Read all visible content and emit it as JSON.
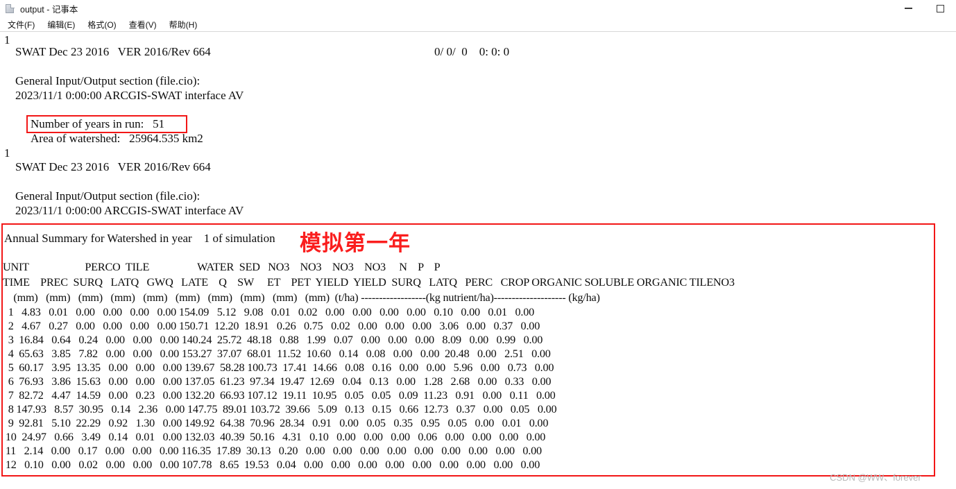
{
  "window": {
    "title": "output - 记事本",
    "icon": "notepad-icon",
    "minimize_label": "−",
    "maximize_label": "□"
  },
  "menu": {
    "items": [
      {
        "label": "文件(F)"
      },
      {
        "label": "编辑(E)"
      },
      {
        "label": "格式(O)"
      },
      {
        "label": "查看(V)"
      },
      {
        "label": "帮助(H)"
      }
    ]
  },
  "document": {
    "page_break_1": "1",
    "header_line_1": "SWAT Dec 23 2016   VER 2016/Rev 664",
    "header_timestamp_1": "0/ 0/  0    0: 0: 0",
    "section_title_1": "General Input/Output section (file.cio):",
    "section_date_1": "2023/11/1 0:00:00 ARCGIS-SWAT interface AV",
    "years_in_run": "Number of years in run:   51",
    "area_of_watershed": "Area of watershed:   25964.535 km2",
    "page_break_2": "1",
    "header_line_2": "SWAT Dec 23 2016   VER 2016/Rev 664",
    "section_title_2": "General Input/Output section (file.cio):",
    "section_date_2": "2023/11/1 0:00:00 ARCGIS-SWAT interface AV",
    "annual_summary_title": "Annual Summary for Watershed in year    1 of simulation",
    "chinese_annotation": "模拟第一年"
  },
  "table": {
    "header_row_1": "UNIT                     PERCO  TILE                  WATER  SED   NO3    NO3    NO3    NO3     N    P    P",
    "header_row_2": "TIME    PREC  SURQ   LATQ   GWQ   LATE    Q    SW     ET    PET  YIELD  YIELD  SURQ   LATQ   PERC   CROP ORGANIC SOLUBLE ORGANIC TILENO3",
    "header_row_3": "    (mm)   (mm)   (mm)   (mm)   (mm)   (mm)   (mm)   (mm)   (mm)   (mm)  (t/ha) ------------------(kg nutrient/ha)-------------------- (kg/ha)",
    "columns": [
      "TIME",
      "PREC",
      "SURQ",
      "LATQ",
      "GWQ",
      "LATE",
      "Q",
      "SW",
      "ET",
      "PET",
      "SED YIELD",
      "NO3 YIELD",
      "NO3 SURQ",
      "NO3 LATQ",
      "NO3 PERC",
      "NO3 CROP",
      "N ORGANIC",
      "P SOLUBLE",
      "P ORGANIC",
      "TILENO3"
    ],
    "rows": [
      {
        "cells": "  1   4.83   0.01   0.00   0.00   0.00   0.00 154.09   5.12   9.08   0.01   0.02   0.00   0.00   0.00   0.00   0.10   0.00   0.01   0.00"
      },
      {
        "cells": "  2   4.67   0.27   0.00   0.00   0.00   0.00 150.71  12.20  18.91   0.26   0.75   0.02   0.00   0.00   0.00   3.06   0.00   0.37   0.00"
      },
      {
        "cells": "  3  16.84   0.64   0.24   0.00   0.00   0.00 140.24  25.72  48.18   0.88   1.99   0.07   0.00   0.00   0.00   8.09   0.00   0.99   0.00"
      },
      {
        "cells": "  4  65.63   3.85   7.82   0.00   0.00   0.00 153.27  37.07  68.01  11.52  10.60   0.14   0.08   0.00   0.00  20.48   0.00   2.51   0.00"
      },
      {
        "cells": "  5  60.17   3.95  13.35   0.00   0.00   0.00 139.67  58.28 100.73  17.41  14.66   0.08   0.16   0.00   0.00   5.96   0.00   0.73   0.00"
      },
      {
        "cells": "  6  76.93   3.86  15.63   0.00   0.00   0.00 137.05  61.23  97.34  19.47  12.69   0.04   0.13   0.00   1.28   2.68   0.00   0.33   0.00"
      },
      {
        "cells": "  7  82.72   4.47  14.59   0.00   0.23   0.00 132.20  66.93 107.12  19.11  10.95   0.05   0.05   0.09  11.23   0.91   0.00   0.11   0.00"
      },
      {
        "cells": "  8 147.93   8.57  30.95   0.14   2.36   0.00 147.75  89.01 103.72  39.66   5.09   0.13   0.15   0.66  12.73   0.37   0.00   0.05   0.00"
      },
      {
        "cells": "  9  92.81   5.10  22.29   0.92   1.30   0.00 149.92  64.38  70.96  28.34   0.91   0.00   0.05   0.35   0.95   0.05   0.00   0.01   0.00"
      },
      {
        "cells": " 10  24.97   0.66   3.49   0.14   0.01   0.00 132.03  40.39  50.16   4.31   0.10   0.00   0.00   0.00   0.06   0.00   0.00   0.00   0.00"
      },
      {
        "cells": " 11   2.14   0.00   0.17   0.00   0.00   0.00 116.35  17.89  30.13   0.20   0.00   0.00   0.00   0.00   0.00   0.00   0.00   0.00   0.00"
      },
      {
        "cells": " 12   0.10   0.00   0.02   0.00   0.00   0.00 107.78   8.65  19.53   0.04   0.00   0.00   0.00   0.00   0.00   0.00   0.00   0.00   0.00"
      }
    ]
  },
  "watermark": {
    "text": "CSDN @WW、forever"
  },
  "colors": {
    "annotation_red": "#f21616",
    "chinese_red": "#fa1e1e",
    "text": "#0c0c0c",
    "watermark": "#b8b8b8"
  },
  "chart_data": {
    "type": "table",
    "title": "Annual Summary for Watershed in year 1 of simulation",
    "categories": [
      "1",
      "2",
      "3",
      "4",
      "5",
      "6",
      "7",
      "8",
      "9",
      "10",
      "11",
      "12"
    ],
    "xlabel": "TIME (month)",
    "ylabel": "",
    "series": [
      {
        "name": "PREC (mm)",
        "values": [
          4.83,
          4.67,
          16.84,
          65.63,
          60.17,
          76.93,
          82.72,
          147.93,
          92.81,
          24.97,
          2.14,
          0.1
        ]
      },
      {
        "name": "SURQ (mm)",
        "values": [
          0.01,
          0.27,
          0.64,
          3.85,
          3.95,
          3.86,
          4.47,
          8.57,
          5.1,
          0.66,
          0.0,
          0.0
        ]
      },
      {
        "name": "LATQ (mm)",
        "values": [
          0.0,
          0.0,
          0.24,
          7.82,
          13.35,
          15.63,
          14.59,
          30.95,
          22.29,
          3.49,
          0.17,
          0.02
        ]
      },
      {
        "name": "GWQ (mm)",
        "values": [
          0.0,
          0.0,
          0.0,
          0.0,
          0.0,
          0.0,
          0.0,
          0.14,
          0.92,
          0.14,
          0.0,
          0.0
        ]
      },
      {
        "name": "LATE (mm)",
        "values": [
          0.0,
          0.0,
          0.0,
          0.0,
          0.0,
          0.0,
          0.23,
          2.36,
          1.3,
          0.01,
          0.0,
          0.0
        ]
      },
      {
        "name": "PERCO Q (mm)",
        "values": [
          0.0,
          0.0,
          0.0,
          0.0,
          0.0,
          0.0,
          0.0,
          0.0,
          0.0,
          0.0,
          0.0,
          0.0
        ]
      },
      {
        "name": "TILE SW (mm)",
        "values": [
          154.09,
          150.71,
          140.24,
          153.27,
          139.67,
          137.05,
          132.2,
          147.75,
          149.92,
          132.03,
          116.35,
          107.78
        ]
      },
      {
        "name": "ET (mm)",
        "values": [
          5.12,
          12.2,
          25.72,
          37.07,
          58.28,
          61.23,
          66.93,
          89.01,
          64.38,
          40.39,
          17.89,
          8.65
        ]
      },
      {
        "name": "PET (mm)",
        "values": [
          9.08,
          18.91,
          48.18,
          68.01,
          100.73,
          97.34,
          107.12,
          103.72,
          70.96,
          50.16,
          30.13,
          19.53
        ]
      },
      {
        "name": "WATER YIELD (mm)",
        "values": [
          0.01,
          0.26,
          0.88,
          11.52,
          17.41,
          19.47,
          19.11,
          39.66,
          28.34,
          4.31,
          0.2,
          0.04
        ]
      },
      {
        "name": "SED YIELD (t/ha)",
        "values": [
          0.02,
          0.75,
          1.99,
          10.6,
          14.66,
          12.69,
          10.95,
          5.09,
          0.91,
          0.1,
          0.0,
          0.0
        ]
      },
      {
        "name": "NO3 SURQ (kg/ha)",
        "values": [
          0.0,
          0.02,
          0.07,
          0.14,
          0.08,
          0.04,
          0.05,
          0.13,
          0.0,
          0.0,
          0.0,
          0.0
        ]
      },
      {
        "name": "NO3 LATQ (kg/ha)",
        "values": [
          0.0,
          0.0,
          0.0,
          0.08,
          0.16,
          0.13,
          0.05,
          0.15,
          0.05,
          0.0,
          0.0,
          0.0
        ]
      },
      {
        "name": "NO3 PERC (kg/ha)",
        "values": [
          0.0,
          0.0,
          0.0,
          0.0,
          0.0,
          0.0,
          0.09,
          0.66,
          0.35,
          0.0,
          0.0,
          0.0
        ]
      },
      {
        "name": "NO3 CROP (kg/ha)",
        "values": [
          0.0,
          0.0,
          0.0,
          0.0,
          0.0,
          1.28,
          11.23,
          12.73,
          0.95,
          0.06,
          0.0,
          0.0
        ]
      },
      {
        "name": "N ORGANIC (kg/ha)",
        "values": [
          0.1,
          3.06,
          8.09,
          20.48,
          5.96,
          2.68,
          0.91,
          0.37,
          0.05,
          0.0,
          0.0,
          0.0
        ]
      },
      {
        "name": "P SOLUBLE (kg/ha)",
        "values": [
          0.0,
          0.0,
          0.0,
          0.0,
          0.0,
          0.0,
          0.0,
          0.0,
          0.0,
          0.0,
          0.0,
          0.0
        ]
      },
      {
        "name": "P ORGANIC (kg/ha)",
        "values": [
          0.01,
          0.37,
          0.99,
          2.51,
          0.73,
          0.33,
          0.11,
          0.05,
          0.01,
          0.0,
          0.0,
          0.0
        ]
      },
      {
        "name": "TILENO3 (kg/ha)",
        "values": [
          0.0,
          0.0,
          0.0,
          0.0,
          0.0,
          0.0,
          0.0,
          0.0,
          0.0,
          0.0,
          0.0,
          0.0
        ]
      }
    ]
  }
}
